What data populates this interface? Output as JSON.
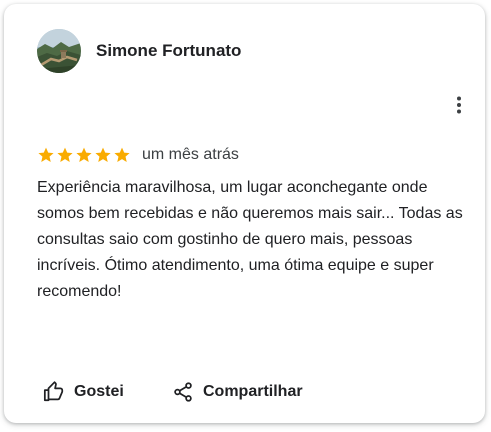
{
  "review": {
    "author_name": "Simone Fortunato",
    "rating": 5,
    "rating_max": 5,
    "time_ago": "um mês atrás",
    "text": "Experiência maravilhosa, um lugar aconchegante onde somos bem recebidas e não queremos mais sair... Todas as consultas saio com gostinho de quero mais, pessoas incríveis. Ótimo atendimento, uma ótima equipe e super recomendo!",
    "avatar_icon": "profile-photo-avatar",
    "star_color": "#F9AB00"
  },
  "actions": {
    "like_label": "Gostei",
    "like_icon": "thumbs-up-icon",
    "share_label": "Compartilhar",
    "share_icon": "share-icon",
    "more_icon": "more-vertical-icon"
  }
}
